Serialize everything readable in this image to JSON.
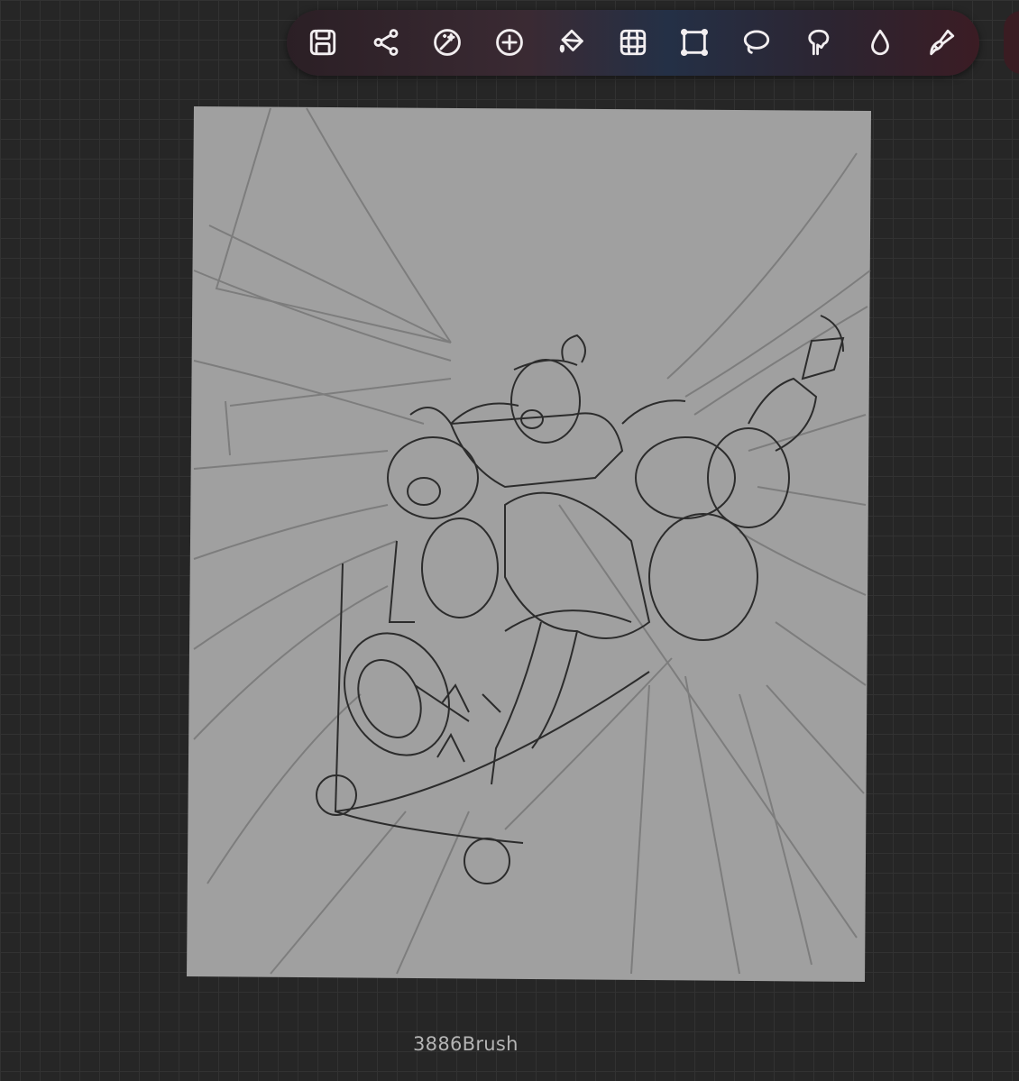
{
  "toolbar": {
    "tools": [
      {
        "icon": "save-icon"
      },
      {
        "icon": "share-icon"
      },
      {
        "icon": "magic-wand-icon"
      },
      {
        "icon": "add-icon"
      },
      {
        "icon": "paint-bucket-icon"
      },
      {
        "icon": "grid-warp-icon"
      },
      {
        "icon": "transform-icon"
      },
      {
        "icon": "lasso-icon"
      },
      {
        "icon": "smudge-icon"
      },
      {
        "icon": "blur-drop-icon"
      },
      {
        "icon": "brush-icon"
      }
    ]
  },
  "canvas": {
    "artboard_color": "#a0a0a0",
    "sketch_color": "#2c2c2c",
    "guide_color": "#787878"
  },
  "status": {
    "brush_label": "3886Brush"
  },
  "colors": {
    "workspace_bg": "#262626",
    "grid_line": "#323232"
  }
}
